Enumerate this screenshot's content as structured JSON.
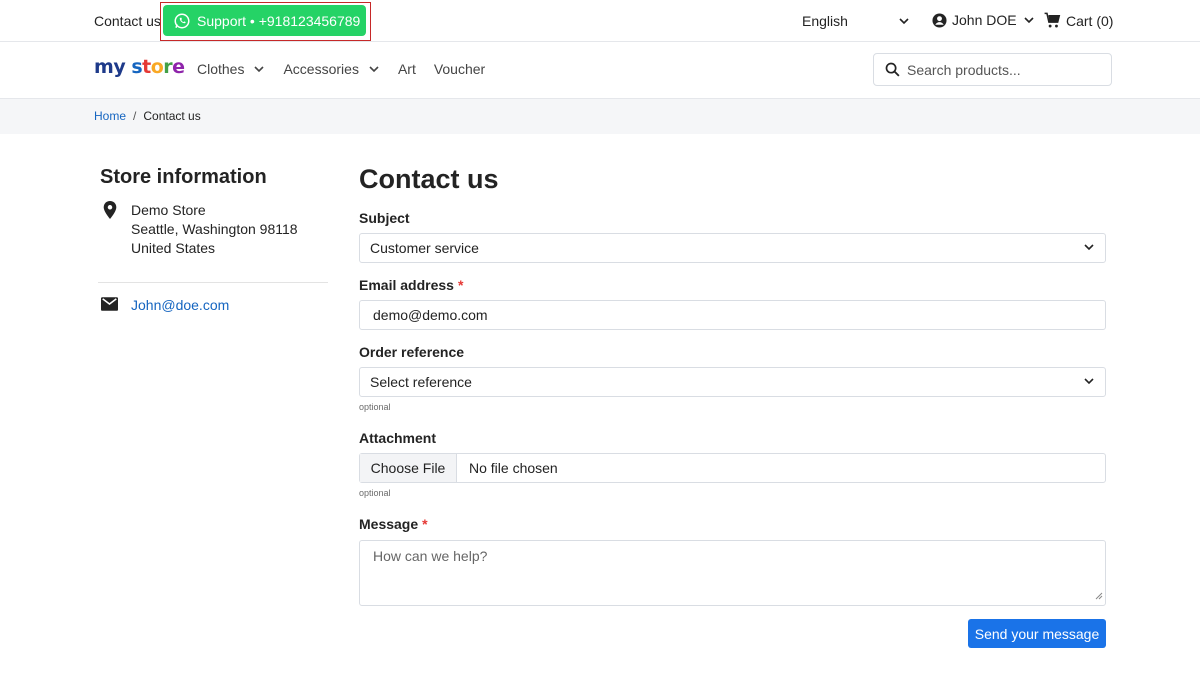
{
  "topbar": {
    "contact_link": "Contact us",
    "support_button": "Support • +918123456789",
    "language": "English",
    "user_name": "John DOE",
    "cart": "Cart (0)"
  },
  "header": {
    "logo_text": "my store",
    "nav": [
      "Clothes",
      "Accessories",
      "Art",
      "Voucher"
    ],
    "search_placeholder": "Search products..."
  },
  "breadcrumb": {
    "home": "Home",
    "separator": "/",
    "current": "Contact us"
  },
  "store_info": {
    "title": "Store information",
    "address_lines": [
      "Demo Store",
      "Seattle, Washington 98118",
      "United States"
    ],
    "email": "John@doe.com"
  },
  "form": {
    "title": "Contact us",
    "subject_label": "Subject",
    "subject_value": "Customer service",
    "email_label": "Email address",
    "email_value": "demo@demo.com",
    "required_mark": "*",
    "order_label": "Order reference",
    "order_value": "Select reference",
    "optional_hint": "optional",
    "attachment_label": "Attachment",
    "choose_file": "Choose File",
    "no_file": "No file chosen",
    "message_label": "Message",
    "message_placeholder": "How can we help?",
    "send_button": "Send your message"
  },
  "colors": {
    "whatsapp_green": "#25d366",
    "highlight_red": "#c62828",
    "link_blue": "#1565c0",
    "primary_button": "#1a73e8",
    "required_red": "#e53935"
  }
}
